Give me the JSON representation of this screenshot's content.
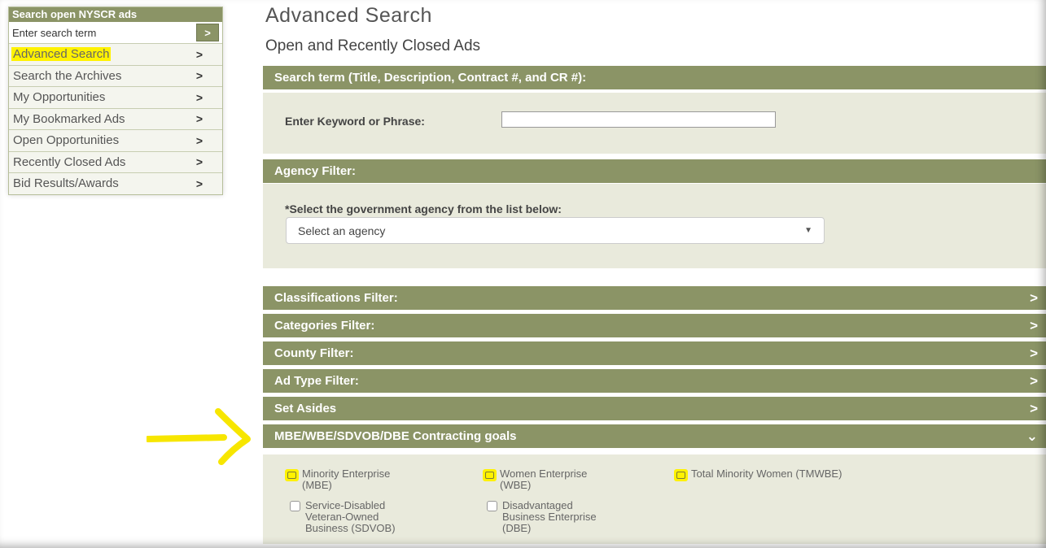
{
  "sidebar": {
    "heading": "Search open NYSCR ads",
    "search_placeholder": "Enter search term",
    "go_label": ">",
    "items": [
      {
        "label": "Advanced Search"
      },
      {
        "label": "Search the Archives"
      },
      {
        "label": "My Opportunities"
      },
      {
        "label": "My Bookmarked Ads"
      },
      {
        "label": "Open Opportunities"
      },
      {
        "label": "Recently Closed Ads"
      },
      {
        "label": "Bid Results/Awards"
      }
    ],
    "chevron": ">"
  },
  "main": {
    "title": "Advanced Search",
    "subtitle": "Open and Recently Closed Ads",
    "search_term": {
      "header": "Search term (Title, Description, Contract #, and CR #):",
      "label": "Enter Keyword or Phrase:",
      "value": ""
    },
    "agency": {
      "header": "Agency Filter:",
      "label": "*Select the government agency from the list below:",
      "selected": "Select an agency",
      "caret": "▼"
    },
    "filters": [
      {
        "label": "Classifications Filter:",
        "icon": ">"
      },
      {
        "label": "Categories Filter:",
        "icon": ">"
      },
      {
        "label": "County Filter:",
        "icon": ">"
      },
      {
        "label": "Ad Type Filter:",
        "icon": ">"
      },
      {
        "label": "Set Asides",
        "icon": ">"
      },
      {
        "label": "MBE/WBE/SDVOB/DBE Contracting goals",
        "icon": "⌄"
      }
    ],
    "goals": {
      "options": [
        {
          "line1": "Minority Enterprise",
          "line2": "(MBE)",
          "line3": ""
        },
        {
          "line1": "Women Enterprise",
          "line2": "(WBE)",
          "line3": ""
        },
        {
          "line1": "Total Minority Women (TMWBE)",
          "line2": "",
          "line3": ""
        },
        {
          "line1": "Service-Disabled",
          "line2": "Veteran-Owned",
          "line3": "Business (SDVOB)"
        },
        {
          "line1": "Disadvantaged",
          "line2": "Business Enterprise",
          "line3": "(DBE)"
        }
      ]
    }
  },
  "colors": {
    "accent_bar": "#8b9466",
    "panel_bg": "#e9eadc",
    "highlight": "#fff200"
  }
}
